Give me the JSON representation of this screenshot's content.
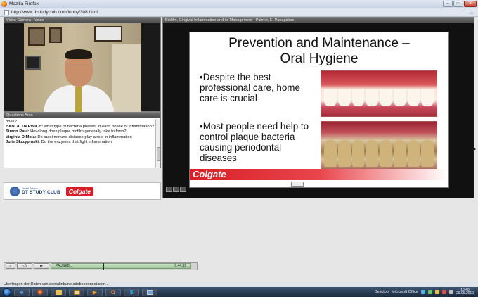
{
  "window": {
    "title": "Mozilla Firefox",
    "url": "http://www.dtstudyclub.com/lobby/308.html"
  },
  "video_pod": {
    "title": "Video Camera - Voice"
  },
  "questions_pod": {
    "title": "Questions Area",
    "messages": [
      {
        "author": "",
        "text": "ones?"
      },
      {
        "author": "HANI ALDARWICH:",
        "text": "what type of bacteria present in each phase of inflammation?"
      },
      {
        "author": "Simon Paul:",
        "text": "How long does plaque biofilm generally take to form?"
      },
      {
        "author": "Virginia DiMola:",
        "text": "Do autoi mmune disiaese play a role in inflammation"
      },
      {
        "author": "Julie Skrzypinski:",
        "text": "Do the enzymes that fight inflammation"
      }
    ]
  },
  "logo_pod": {
    "dt_small": "Dental Tribune",
    "dt_big": "DT STUDY CLUB",
    "colgate": "Colgate"
  },
  "slide_pod": {
    "title": "Biofilm, Gingival Inflammation and its Management - Palmer, E. Panagakos",
    "slide_title_1": "Prevention and Maintenance –",
    "slide_title_2": "Oral Hygiene",
    "bullet_1": "•Despite the best professional care, home care is crucial",
    "bullet_2": "•Most people need help to control plaque bacteria causing periodontal diseases",
    "colgate_band": "Colgate"
  },
  "playbar": {
    "status": "PAUSED...",
    "time": "0:44:39",
    "progress": 0.37
  },
  "statusbar": {
    "text": "Übertragen der Daten von dentaltribune.adobeconnect.com..."
  },
  "taskbar": {
    "desktop_label": "Desktop",
    "office_label": "Microsoft Office",
    "time": "13:48",
    "date": "29.09.2010",
    "apps": [
      "ie-icon",
      "firefox-icon",
      "folder-icon",
      "explorer-icon",
      "media-icon",
      "paint-icon",
      "skype-icon",
      "screen-icon"
    ]
  }
}
